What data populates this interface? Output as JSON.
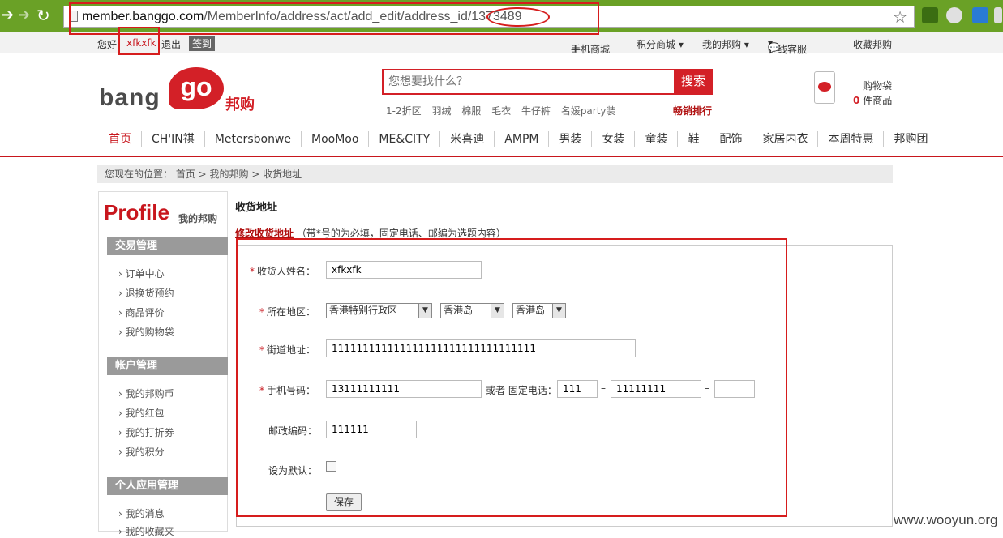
{
  "browser": {
    "url_host": "member.banggo.com",
    "url_path": "/MemberInfo/address/act/add_edit/address_id/1373489",
    "back_icon": "back-arrow-icon",
    "forward_icon": "forward-arrow-icon",
    "reload_icon": "reload-icon",
    "star_icon": "star-icon"
  },
  "topbar": {
    "greeting": "您好!",
    "username": "xfkxfk",
    "logout": "退出",
    "signin": "签到",
    "mobile": "手机商城",
    "points_mall": "积分商城 ▾",
    "my_banggo": "我的邦购 ▾",
    "online_service": "在线客服",
    "favorite": "收藏邦购"
  },
  "header": {
    "logo_bang": "bang",
    "logo_go": "go",
    "logo_cn": "邦购",
    "search_placeholder": "您想要找什么？",
    "search_button": "搜索",
    "hot_links": [
      "1-2折区",
      "羽绒",
      "棉服",
      "毛衣",
      "牛仔裤",
      "名媛party装"
    ],
    "hot_rank": "畅销排行",
    "cart_label": "购物袋",
    "cart_count": "0",
    "cart_unit": "件商品"
  },
  "nav": [
    "首页",
    "CH'IN祺",
    "Metersbonwe",
    "MooMoo",
    "ME&CITY",
    "米喜迪",
    "AMPM",
    "男装",
    "女装",
    "童装",
    "鞋",
    "配饰",
    "家居内衣",
    "本周特惠",
    "邦购团"
  ],
  "breadcrumb": "您现在的位置： 首页 > 我的邦购 > 收货地址",
  "sidebar": {
    "profile_word": "Profile",
    "profile_cn": "我的邦购",
    "sections": [
      {
        "title": "交易管理",
        "items": [
          "订单中心",
          "退换货预约",
          "商品评价",
          "我的购物袋"
        ]
      },
      {
        "title": "帐户管理",
        "items": [
          "我的邦购币",
          "我的红包",
          "我的打折券",
          "我的积分"
        ]
      },
      {
        "title": "个人应用管理",
        "items": [
          "我的消息",
          "我的收藏夹"
        ]
      }
    ]
  },
  "main": {
    "title": "收货地址",
    "sub_title": "修改收货地址",
    "sub_note": "（带*号的为必填，固定电话、邮编为选题内容）",
    "form": {
      "required_mark": "*",
      "name_label": "收货人姓名：",
      "name_value": "xfkxfk",
      "region_label": "所在地区：",
      "province": "香港特别行政区",
      "city": "香港岛",
      "district": "香港岛",
      "street_label": "街道地址：",
      "street_value": "111111111111111111111111111111111",
      "mobile_label": "手机号码：",
      "mobile_value": "13111111111",
      "or_phone": "或者 固定电话：",
      "area_code": "111",
      "dash": "–",
      "phone": "11111111",
      "ext": "",
      "zip_label": "邮政编码：",
      "zip_value": "111111",
      "default_label": "设为默认：",
      "save": "保存"
    }
  },
  "watermark": "www.wooyun.org"
}
